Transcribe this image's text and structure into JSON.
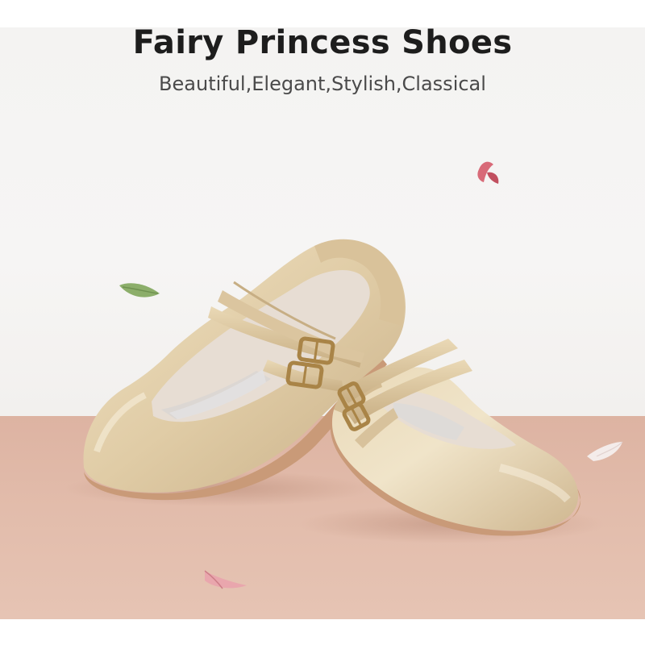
{
  "banner": {
    "title": "Fairy Princess Shoes",
    "subtitle": "Beautiful,Elegant,Stylish,Classical"
  },
  "product": {
    "item": "girls mary jane flat shoes",
    "color_name": "gold",
    "colors": {
      "leather": "#e2cfaa",
      "leather_shadow": "#c7ae84",
      "lining": "#e7ddd3",
      "buckle": "#a98447",
      "sole": "#c99a78",
      "wall": "#f4f3f2",
      "floor": "#ddb3a2"
    }
  },
  "decorations": {
    "petals": [
      "pink-petal",
      "green-leaf",
      "white-petal",
      "pink-petal"
    ]
  }
}
